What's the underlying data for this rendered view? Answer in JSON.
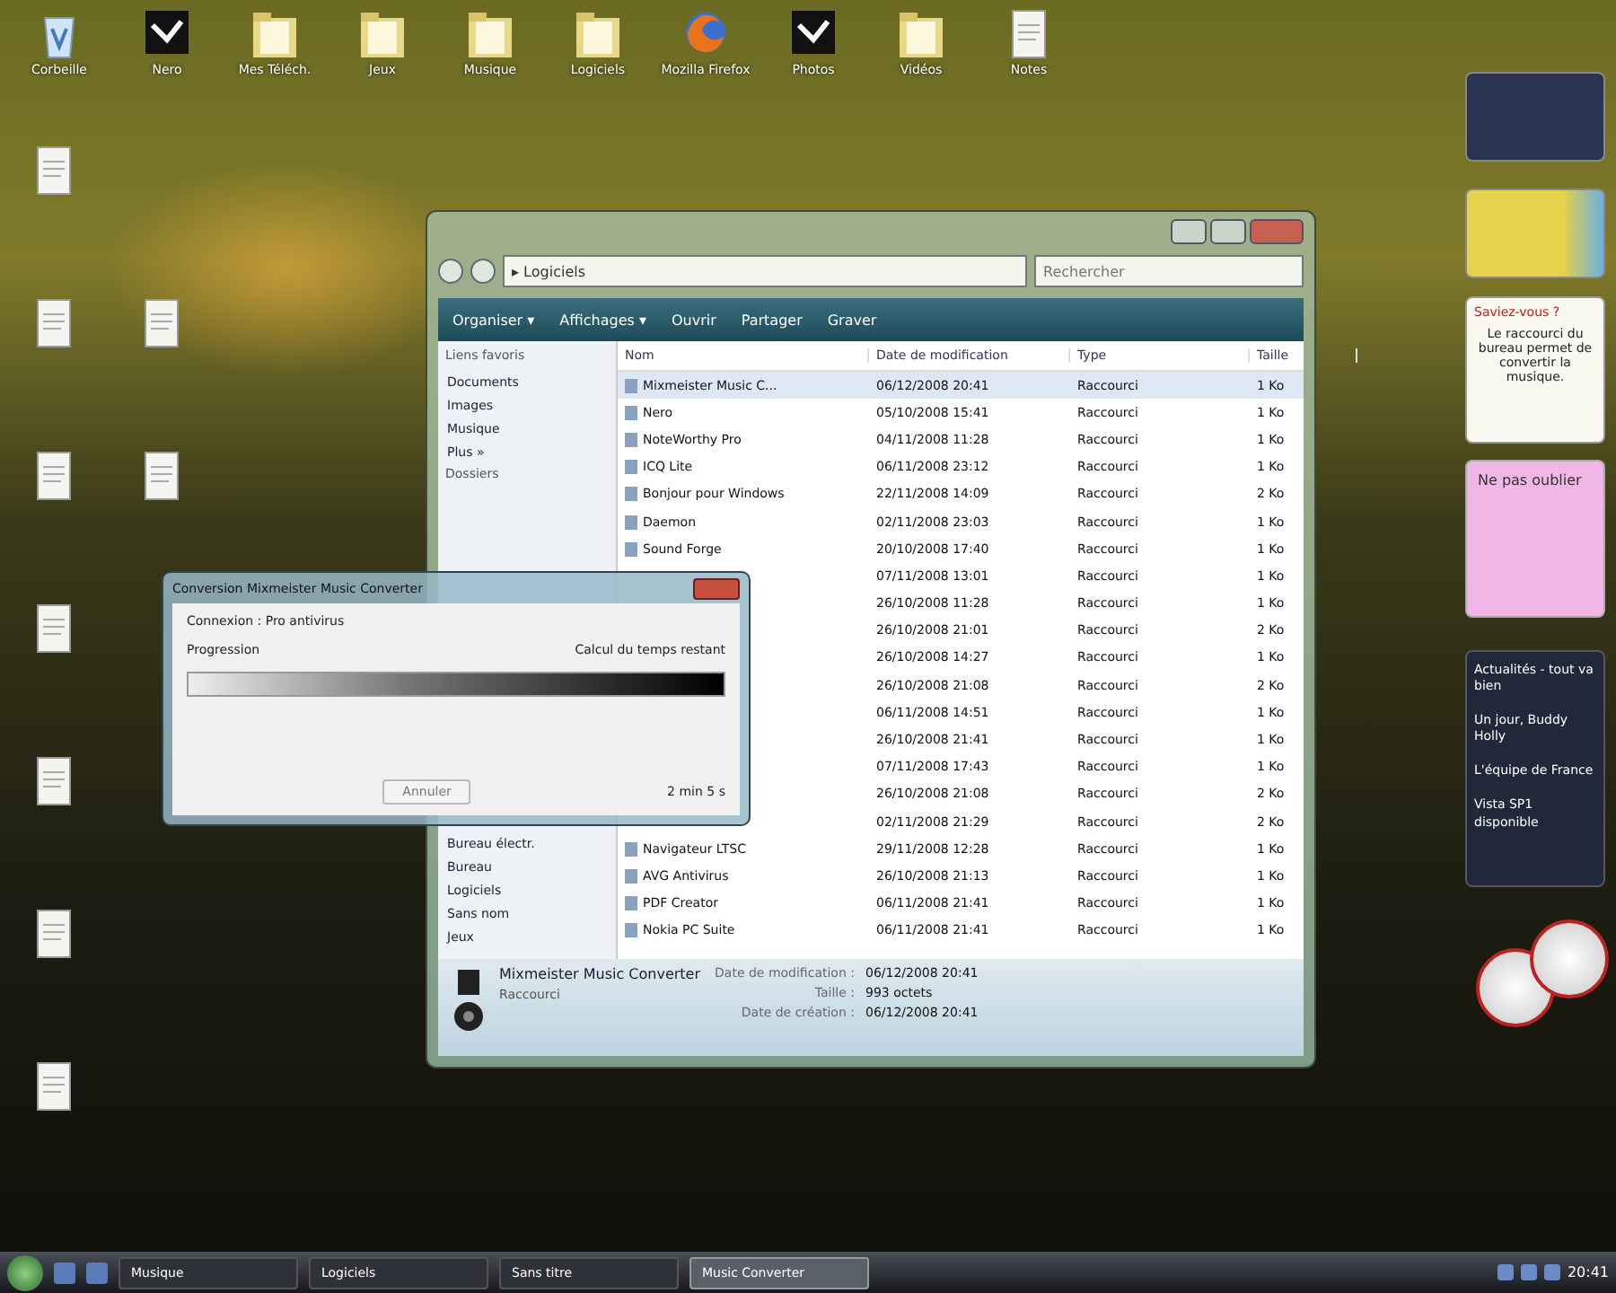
{
  "desktop_icons": [
    {
      "kind": "recycle",
      "label": "Corbeille"
    },
    {
      "kind": "app",
      "label": "Nero"
    },
    {
      "kind": "folder",
      "label": "Mes Téléch."
    },
    {
      "kind": "folder",
      "label": "Jeux"
    },
    {
      "kind": "folder",
      "label": "Musique"
    },
    {
      "kind": "folder",
      "label": "Logiciels"
    },
    {
      "kind": "firefox",
      "label": "Mozilla Firefox"
    },
    {
      "kind": "app",
      "label": "Photos"
    },
    {
      "kind": "folder",
      "label": "Vidéos"
    },
    {
      "kind": "file",
      "label": "Notes"
    }
  ],
  "explorer": {
    "address": "▸ Logiciels",
    "search_placeholder": "Rechercher",
    "commands": [
      "Organiser ▾",
      "Affichages ▾",
      "Ouvrir",
      "Partager",
      "Graver"
    ],
    "nav_heading": "Liens favoris",
    "nav_links": [
      "Documents",
      "Images",
      "Musique",
      "Plus »"
    ],
    "folders_heading": "Dossiers",
    "folders": [
      "Bureau électr.",
      "Bureau",
      "Logiciels",
      "Sans nom",
      "Jeux"
    ],
    "columns": [
      "Nom",
      "Date de modification",
      "Type",
      "Taille"
    ],
    "rows": [
      {
        "name": "Mixmeister Music C...",
        "date": "06/12/2008 20:41",
        "type": "Raccourci",
        "size": "1 Ko",
        "selected": true
      },
      {
        "name": "Nero",
        "date": "05/10/2008 15:41",
        "type": "Raccourci",
        "size": "1 Ko",
        "selected": false
      },
      {
        "name": "NoteWorthy Pro",
        "date": "04/11/2008 11:28",
        "type": "Raccourci",
        "size": "1 Ko",
        "selected": false
      },
      {
        "name": "ICQ Lite",
        "date": "06/11/2008 23:12",
        "type": "Raccourci",
        "size": "1 Ko",
        "selected": false
      },
      {
        "name": "Bonjour pour Windows",
        "date": "22/11/2008 14:09",
        "type": "Raccourci",
        "size": "2 Ko",
        "selected": false
      },
      {
        "name": "Daemon",
        "date": "02/11/2008 23:03",
        "type": "Raccourci",
        "size": "1 Ko",
        "selected": false
      },
      {
        "name": "Sound Forge",
        "date": "20/10/2008 17:40",
        "type": "Raccourci",
        "size": "1 Ko",
        "selected": false
      },
      {
        "date": "07/11/2008 13:01",
        "type": "Raccourci",
        "size": "1 Ko",
        "selected": false
      },
      {
        "date": "26/10/2008 11:28",
        "type": "Raccourci",
        "size": "1 Ko",
        "selected": false
      },
      {
        "date": "26/10/2008 21:01",
        "type": "Raccourci",
        "size": "2 Ko",
        "selected": false
      },
      {
        "date": "26/10/2008 14:27",
        "type": "Raccourci",
        "size": "1 Ko",
        "selected": false
      },
      {
        "date": "26/10/2008 21:08",
        "type": "Raccourci",
        "size": "2 Ko",
        "selected": false
      },
      {
        "date": "06/11/2008 14:51",
        "type": "Raccourci",
        "size": "1 Ko",
        "selected": false
      },
      {
        "date": "26/10/2008 21:41",
        "type": "Raccourci",
        "size": "1 Ko",
        "selected": false
      },
      {
        "date": "07/11/2008 17:43",
        "type": "Raccourci",
        "size": "1 Ko",
        "selected": false
      },
      {
        "date": "26/10/2008 21:08",
        "type": "Raccourci",
        "size": "2 Ko",
        "selected": false
      },
      {
        "date": "02/11/2008 21:29",
        "type": "Raccourci",
        "size": "2 Ko",
        "selected": false
      },
      {
        "name": "Navigateur LTSC",
        "date": "29/11/2008 12:28",
        "type": "Raccourci",
        "size": "1 Ko",
        "selected": false
      },
      {
        "name": "AVG Antivirus",
        "date": "26/10/2008 21:13",
        "type": "Raccourci",
        "size": "1 Ko",
        "selected": false
      },
      {
        "name": "PDF Creator",
        "date": "06/11/2008 21:41",
        "type": "Raccourci",
        "size": "1 Ko",
        "selected": false
      },
      {
        "name": "Nokia PC Suite",
        "date": "06/11/2008 21:41",
        "type": "Raccourci",
        "size": "1 Ko",
        "selected": false
      }
    ],
    "details": {
      "name": "Mixmeister Music Converter",
      "type": "Raccourci",
      "fields": [
        {
          "label": "Date de modification :",
          "value": "06/12/2008 20:41"
        },
        {
          "label": "Taille :",
          "value": "993 octets"
        },
        {
          "label": "Date de création :",
          "value": "06/12/2008 20:41"
        }
      ]
    }
  },
  "dialog": {
    "title": "Conversion Mixmeister Music Converter",
    "status": "Connexion : Pro antivirus",
    "progress_label": "Progression",
    "progress_right": "Calcul du temps restant",
    "level": 1.0,
    "cancel": "Annuler",
    "cancel_disabled": true,
    "time": "2 min 5 s"
  },
  "gadgets": {
    "note_title": "Saviez-vous ?",
    "note_text": "Le raccourci du bureau permet de convertir la musique.",
    "sticky": "Ne pas oublier",
    "feed": [
      "Actualités - tout va bien",
      "Un jour, Buddy Holly",
      "L'équipe de France",
      "Vista SP1 disponible"
    ]
  },
  "taskbar": {
    "buttons": [
      {
        "label": "Musique",
        "selected": false
      },
      {
        "label": "Logiciels",
        "selected": false
      },
      {
        "label": "Sans titre",
        "selected": false
      },
      {
        "label": "Music Converter",
        "selected": true
      }
    ],
    "clock": "20:41"
  }
}
